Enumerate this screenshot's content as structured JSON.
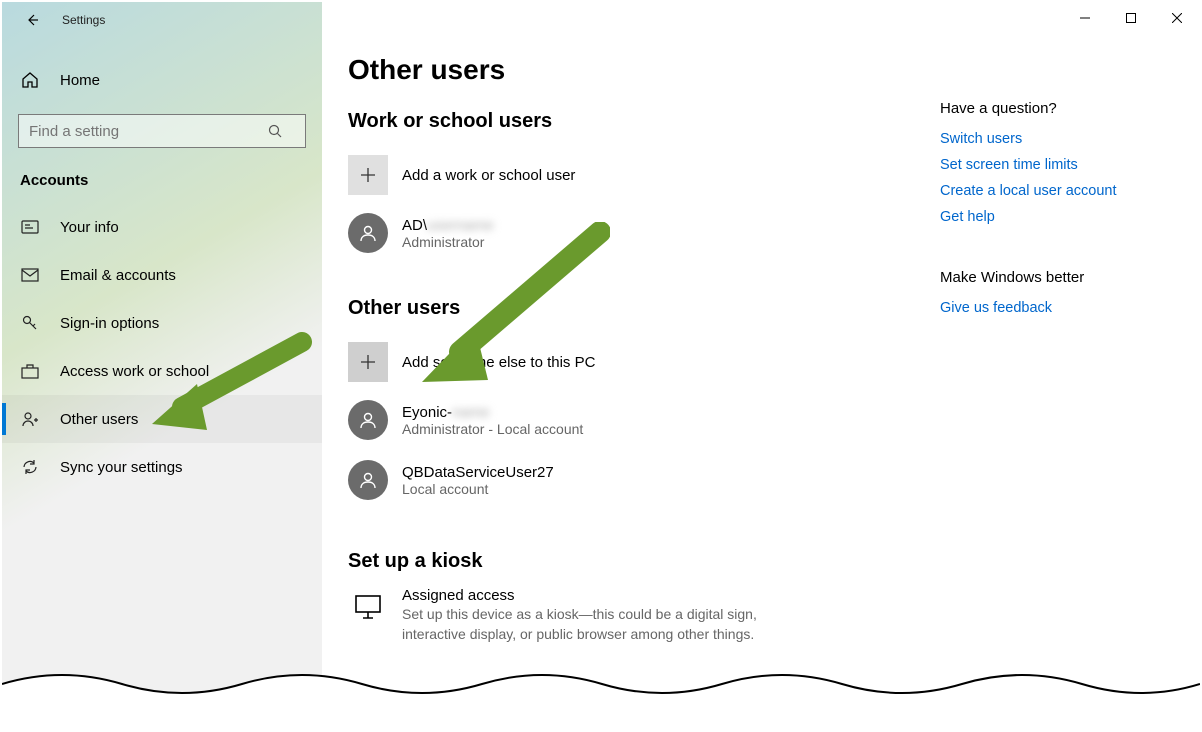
{
  "window": {
    "title": "Settings"
  },
  "sidebar": {
    "home": "Home",
    "search_placeholder": "Find a setting",
    "section_label": "Accounts",
    "items": [
      {
        "label": "Your info"
      },
      {
        "label": "Email & accounts"
      },
      {
        "label": "Sign-in options"
      },
      {
        "label": "Access work or school"
      },
      {
        "label": "Other users"
      },
      {
        "label": "Sync your settings"
      }
    ]
  },
  "page": {
    "title": "Other users",
    "sections": {
      "work": {
        "heading": "Work or school users",
        "add_label": "Add a work or school user",
        "users": [
          {
            "name": "AD\\",
            "role": "Administrator"
          }
        ]
      },
      "other": {
        "heading": "Other users",
        "add_label": "Add someone else to this PC",
        "users": [
          {
            "name": "Eyonic-",
            "role": "Administrator - Local account"
          },
          {
            "name": "QBDataServiceUser27",
            "role": "Local account"
          }
        ]
      },
      "kiosk": {
        "heading": "Set up a kiosk",
        "title": "Assigned access",
        "desc": "Set up this device as a kiosk—this could be a digital sign, interactive display, or public browser among other things."
      }
    }
  },
  "help": {
    "q_heading": "Have a question?",
    "links": [
      "Switch users",
      "Set screen time limits",
      "Create a local user account",
      "Get help"
    ],
    "better_heading": "Make Windows better",
    "feedback": "Give us feedback"
  }
}
